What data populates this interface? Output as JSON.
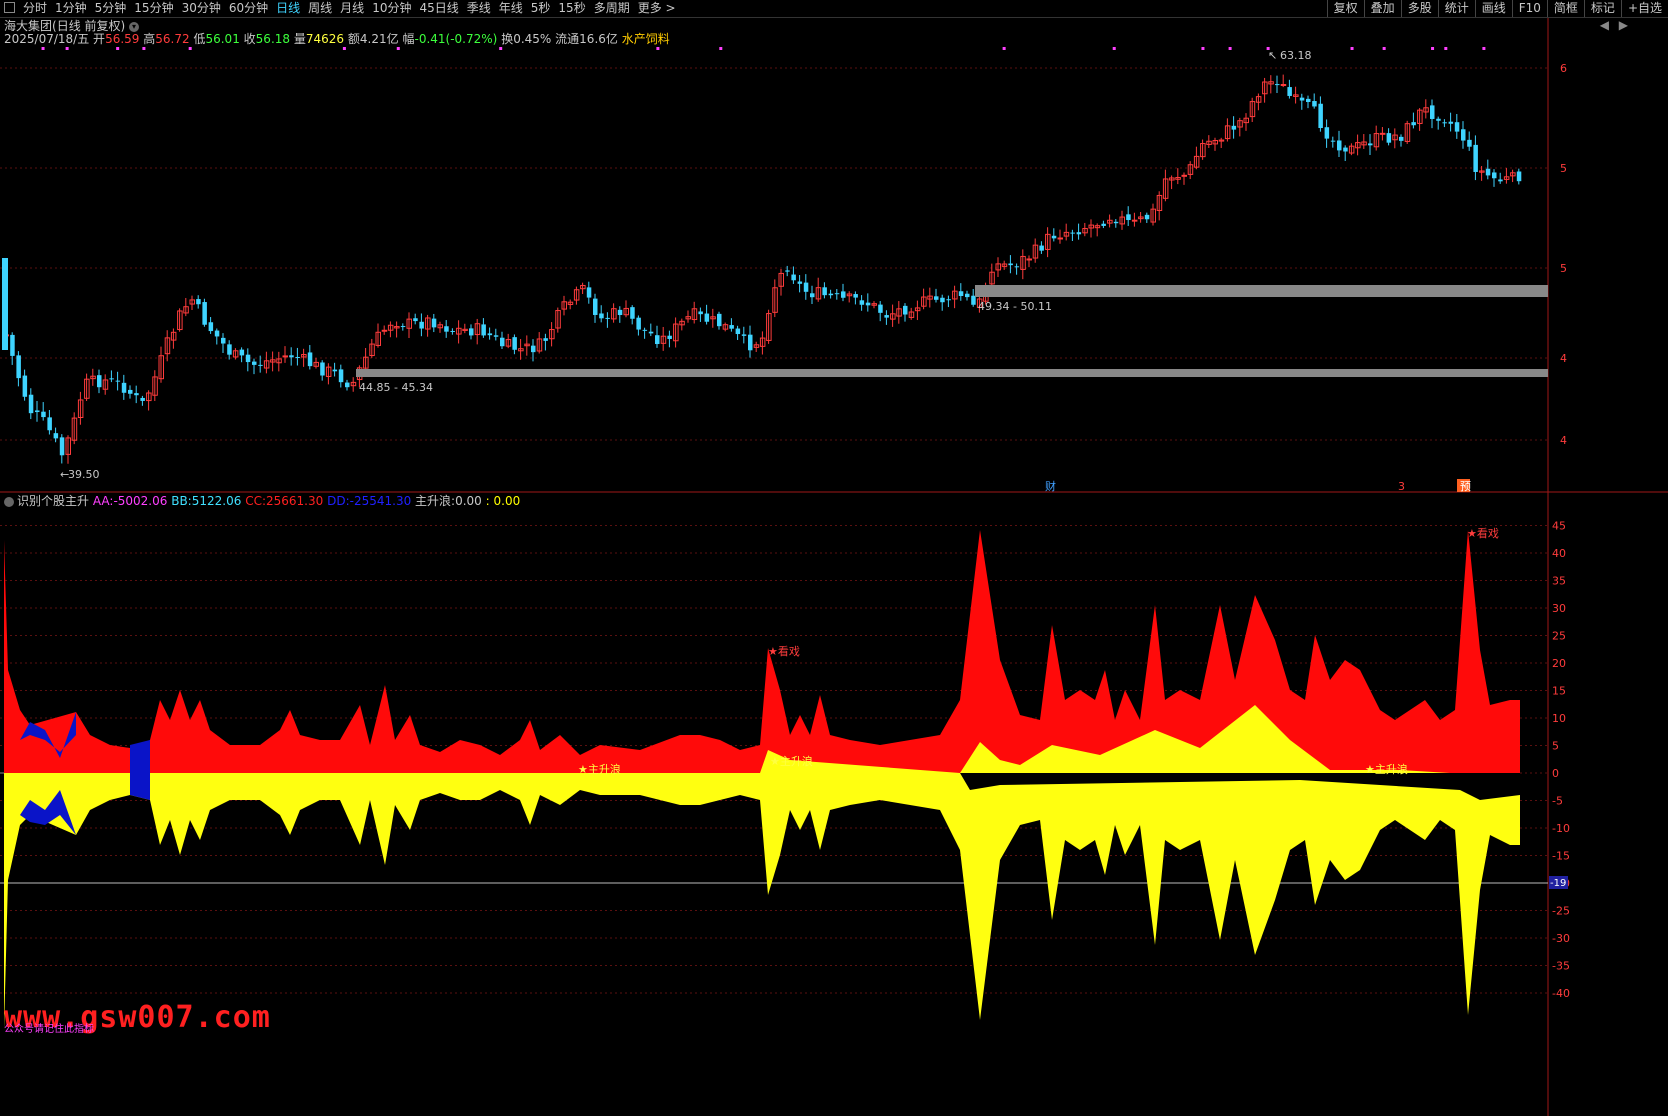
{
  "toolbar": {
    "tabs": [
      "分时",
      "1分钟",
      "5分钟",
      "15分钟",
      "30分钟",
      "60分钟",
      "日线",
      "周线",
      "月线",
      "10分钟",
      "45日线",
      "季线",
      "年线",
      "5秒",
      "15秒",
      "多周期",
      "更多 >"
    ],
    "active_tab": "日线",
    "right_buttons": [
      "复权",
      "叠加",
      "多股",
      "统计",
      "画线",
      "F10",
      "简框",
      "标记",
      "+自选"
    ]
  },
  "stock": {
    "name": "海大集团",
    "mode": "(日线 前复权)",
    "date": "2025/07/18/五",
    "open_label": "开",
    "open": "56.59",
    "high_label": "高",
    "high": "56.72",
    "low_label": "低",
    "low": "56.01",
    "close_label": "收",
    "close": "56.18",
    "vol_label": "量",
    "vol": "74626",
    "amount_label": "额",
    "amount": "4.21亿",
    "change_label": "幅",
    "change": "-0.41(-0.72%)",
    "turnover_label": "换",
    "turnover": "0.45%",
    "float_label": "流通",
    "float": "16.6亿",
    "sector": "水产饲料"
  },
  "price_chart": {
    "high_marker": "63.18",
    "low_marker": "39.50",
    "zone1_label": "44.85 - 45.34",
    "zone2_label": "49.34 - 50.11",
    "axis_labels": [
      "6",
      "5",
      "5",
      "4",
      "4"
    ],
    "event_markers": [
      "财",
      "3",
      "预"
    ],
    "colors": {
      "up": "#ff3c3c",
      "down": "#3fd4ff",
      "zone": "#888888"
    }
  },
  "indicator": {
    "name": "识别个股主升",
    "aa_label": "AA:",
    "aa": "-5002.06",
    "bb_label": "BB:",
    "bb": "5122.06",
    "cc_label": "CC:",
    "cc": "25661.30",
    "dd_label": "DD:",
    "dd": "-25541.30",
    "zs_label": "主升浪:",
    "zs": "0.00",
    "zs2": ": 0.00",
    "annotations": [
      "★看戏",
      "★主升浪",
      "★主升浪",
      "★主升浪",
      "★看戏"
    ],
    "axis_labels": [
      "45",
      "40",
      "35",
      "30",
      "25",
      "20",
      "15",
      "10",
      "5",
      "0",
      "-5",
      "-10",
      "-15",
      "-20",
      "-25",
      "-30",
      "-35",
      "-40"
    ],
    "cursor_value": "-19",
    "colors": {
      "aa": "#ff40ff",
      "bb": "#40e0ff",
      "cc": "#ff2020",
      "dd": "#2020ff",
      "zs": "#ffff00"
    }
  },
  "watermark": {
    "text": "www.gsw007.com",
    "sub": "公众号请记住此指标"
  }
}
